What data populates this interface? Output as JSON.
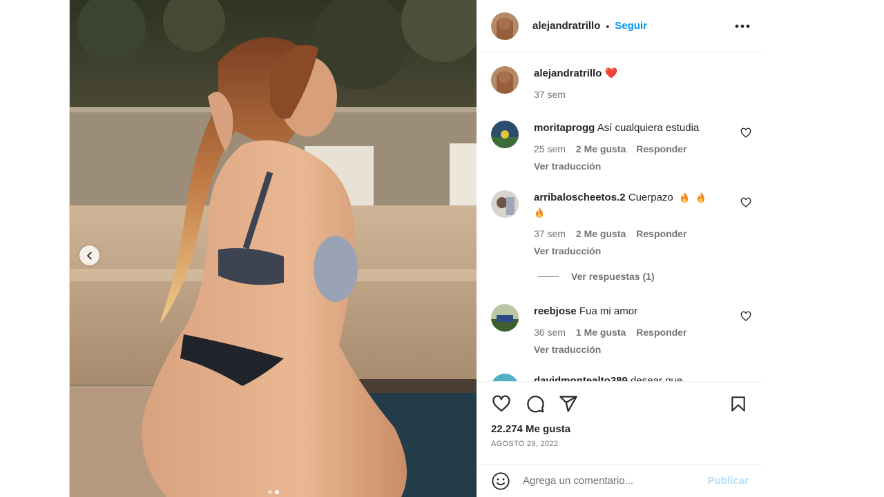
{
  "post": {
    "username": "alejandratrillo",
    "separator": "•",
    "follow_label": "Seguir",
    "caption": {
      "username": "alejandratrillo",
      "emoji": "❤️",
      "age": "37 sem"
    },
    "comments": [
      {
        "username": "moritaprogg",
        "text": "Así cualquiera estudia",
        "age": "25 sem",
        "likes": "2 Me gusta",
        "reply": "Responder",
        "translate": "Ver traducción"
      },
      {
        "username": "arribaloscheetos.2",
        "text": "Cuerpazo",
        "age": "37 sem",
        "likes": "2 Me gusta",
        "reply": "Responder",
        "translate": "Ver traducción",
        "view_replies": "Ver respuestas (1)"
      },
      {
        "username": "reebjose",
        "text": "Fua mi amor",
        "age": "36 sem",
        "likes": "1 Me gusta",
        "reply": "Responder",
        "translate": "Ver traducción"
      },
      {
        "username": "davidmontealto389",
        "text": "desear que"
      }
    ],
    "likes_count": "22.274 Me gusta",
    "date": "AGOSTO 29, 2022",
    "comment_placeholder": "Agrega un comentario...",
    "publish_label": "Publicar",
    "carousel": {
      "total": 2,
      "current": 2
    }
  },
  "icons": {
    "more": "more-horizontal-icon",
    "like": "heart-icon",
    "comment": "comment-icon",
    "share": "send-icon",
    "save": "bookmark-icon",
    "emoji": "emoji-icon",
    "prev": "chevron-left-icon",
    "fire": "fire-icon"
  },
  "colors": {
    "link": "#0095f6",
    "publish_disabled": "#b2dffc",
    "secondary_text": "#737373",
    "heart": "#ed4956"
  }
}
